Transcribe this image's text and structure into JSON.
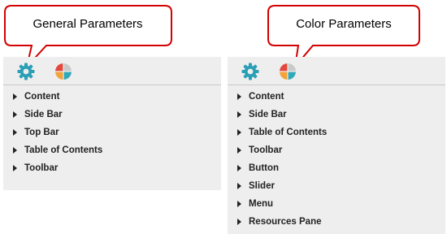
{
  "callouts": {
    "general": "General Parameters",
    "color": "Color Parameters"
  },
  "colors": {
    "callout_border": "#d40000",
    "panel_bg": "#eeeeee",
    "gear": "#2a9fb6",
    "wheel": [
      "#e3483b",
      "#f2a33a",
      "#31a9b8",
      "#c9c9c9"
    ]
  },
  "icons": {
    "settings_tab": "gear-icon",
    "color_tab": "color-wheel-icon",
    "item_marker": "caret-right-icon"
  },
  "general_panel": {
    "items": [
      {
        "label": "Content"
      },
      {
        "label": "Side Bar"
      },
      {
        "label": "Top Bar"
      },
      {
        "label": "Table of Contents"
      },
      {
        "label": "Toolbar"
      }
    ]
  },
  "color_panel": {
    "items": [
      {
        "label": "Content"
      },
      {
        "label": "Side Bar"
      },
      {
        "label": "Table of Contents"
      },
      {
        "label": "Toolbar"
      },
      {
        "label": "Button"
      },
      {
        "label": "Slider"
      },
      {
        "label": "Menu"
      },
      {
        "label": "Resources Pane"
      }
    ]
  }
}
